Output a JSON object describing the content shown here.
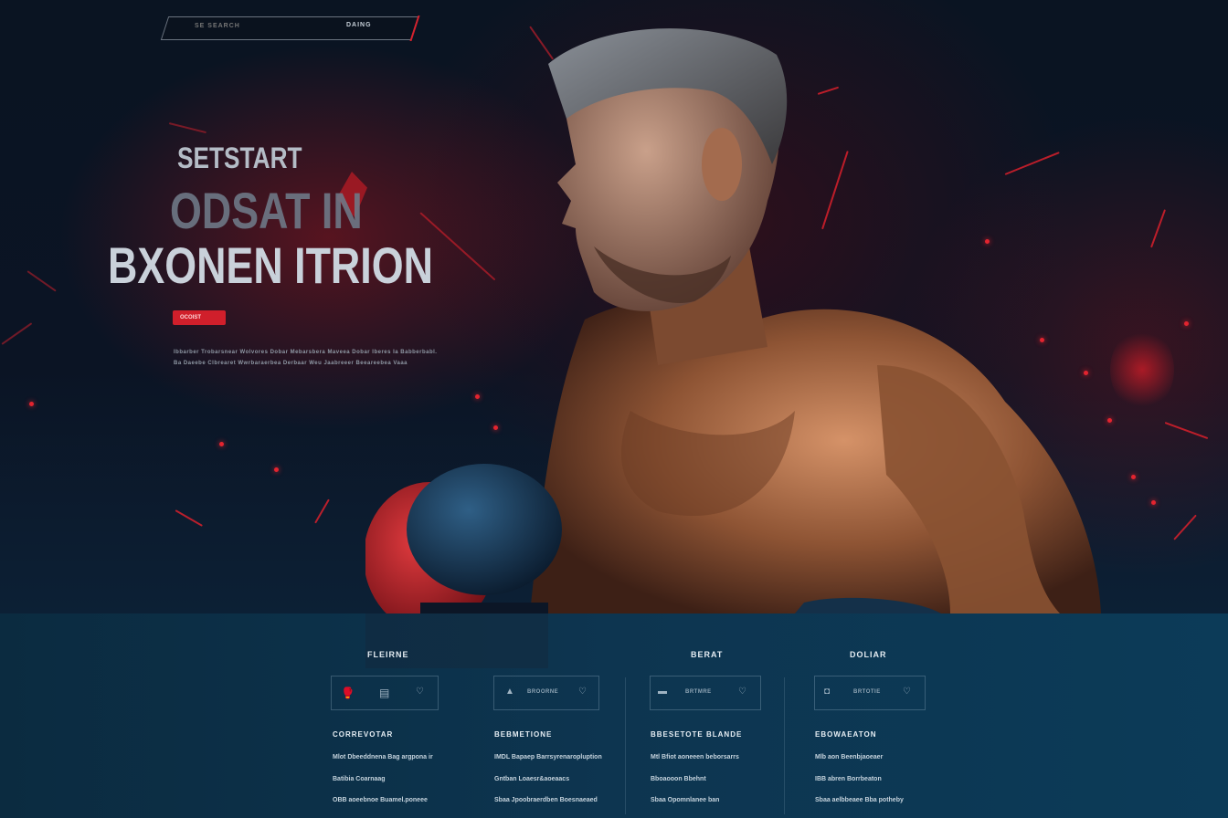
{
  "search": {
    "placeholder": "SE SEARCH",
    "button_label": "DAING"
  },
  "hero": {
    "eyebrow": "SETSTART",
    "headline_line1": "ODSAT IN",
    "headline_line2": "BXONEN ITRION",
    "cta_label": "OCOIST",
    "description_line1": "Ibbarber Trobarsnear Wolvores  Dobar Mebarsbera Maveea Dobar Iberes Ia Babberbabl.",
    "description_line2": "Ba Daeebe Clbrearet Wwrbaraerbea Derbaar Weu Jaabreeer Beeareebea Vaaa"
  },
  "footer": {
    "columns": [
      {
        "heading": "FLEIRNE",
        "icon_label": "",
        "icons": [
          "glove-icon",
          "pads-icon",
          "gloves-pair-icon"
        ],
        "sub_heading": "CORREVOTAR",
        "links": [
          "Mlot Dbeeddnena Bag argpona ir",
          "Batibia Coarnaag",
          "OBB aoeebnoe Buamel.poneee"
        ]
      },
      {
        "heading": "",
        "icon_label": "BROORNE",
        "icons": [
          "bottle-icon",
          "gloves-pair-icon"
        ],
        "sub_heading": "BEBMETIONE",
        "links": [
          "IMDL Bapaep Barrsyrenaropluption",
          "Gntban Loaesr&aoeaacs",
          "Sbaa Jpoobraerdben Boesnaeaed"
        ]
      },
      {
        "heading": "BERAT",
        "icon_label": "BRTMRE",
        "icons": [
          "shoe-icon",
          "gloves-pair-icon"
        ],
        "sub_heading": "BBESETOTE BLANDE",
        "links": [
          "Mtl Bfiot aoneeen beborsarrs",
          "Bboaooon Bbehnt",
          "Sbaa Opomnlanee ban"
        ]
      },
      {
        "heading": "DOLIAR",
        "icon_label": "BRTOTIE",
        "icons": [
          "headgear-icon",
          "gloves-pair-icon"
        ],
        "sub_heading": "EBOWAEATON",
        "links": [
          "Mlb aon Beenbjaoeaer",
          "IBB abren Borrbeaton",
          "Sbaa aelbbeaee Bba potheby"
        ]
      }
    ]
  },
  "colors": {
    "accent_red": "#d01f2b",
    "footer_blue": "#0d3550",
    "background_dark": "#07101c"
  }
}
